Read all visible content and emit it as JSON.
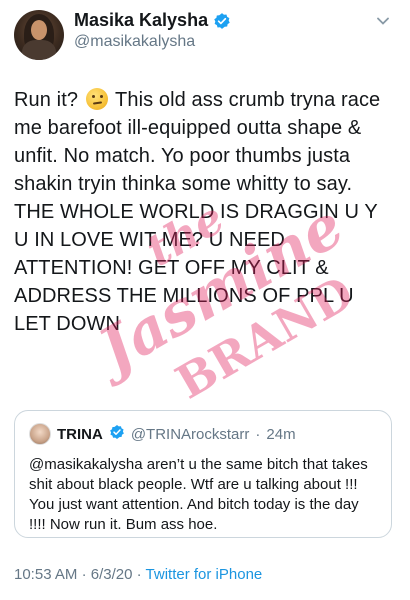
{
  "author": {
    "display_name": "Masika Kalysha",
    "handle": "@masikakalysha"
  },
  "tweet": {
    "text_part1": "Run it?",
    "text_part2": "This old ass crumb tryna race me barefoot ill-equipped outta shape & unfit. No match. Yo poor thumbs justa shakin tryin thinka some whitty to say. THE WHOLE WORLD IS DRAGGIN U Y U IN LOVE WIT ME? U NEED ATTENTION! GET OFF MY CLIT & ADDRESS THE MILLIONS OF PPL U LET DOWN",
    "emoji": "thinking-face-emoji"
  },
  "quoted_tweet": {
    "display_name": "TRINA",
    "handle": "@TRINArockstarr",
    "dot": "·",
    "time": "24m",
    "text": "@masikakalysha aren’t u the same bitch that takes shit about black people. Wtf are u talking about !!! You just want attention. And bitch today is the day !!!! Now run it. Bum ass hoe."
  },
  "meta": {
    "time": "10:53 AM",
    "dot1": "·",
    "date": "6/3/20",
    "dot2": "·",
    "source": "Twitter for iPhone"
  },
  "watermark": {
    "line1": "the",
    "line2": "Jasmine",
    "line3": "BRAND"
  },
  "colors": {
    "verified": "#1da1f2",
    "secondary_text": "#657786",
    "link": "#1b95e0",
    "watermark": "#e01b5a"
  }
}
